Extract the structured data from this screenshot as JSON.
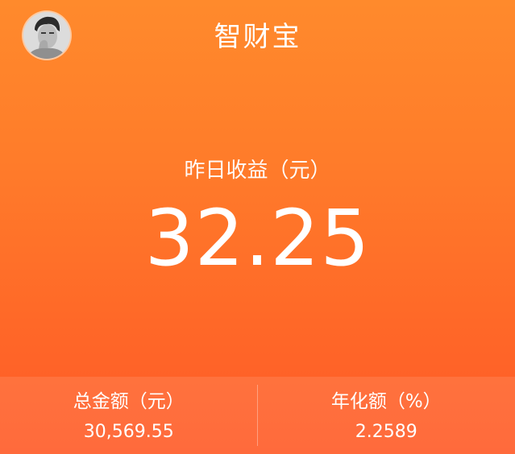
{
  "header": {
    "title": "智财宝",
    "avatar_icon": "user-avatar-icon"
  },
  "yesterday_earnings": {
    "label": "昨日收益（元）",
    "value": "32.25"
  },
  "stats": {
    "total_amount": {
      "label": "总金额（元）",
      "value": "30,569.55"
    },
    "annualized": {
      "label": "年化额（%）",
      "value": "2.2589"
    }
  },
  "colors": {
    "gradient_top": "#ff8a2c",
    "gradient_bottom": "#ff5a26",
    "text": "#ffffff"
  }
}
